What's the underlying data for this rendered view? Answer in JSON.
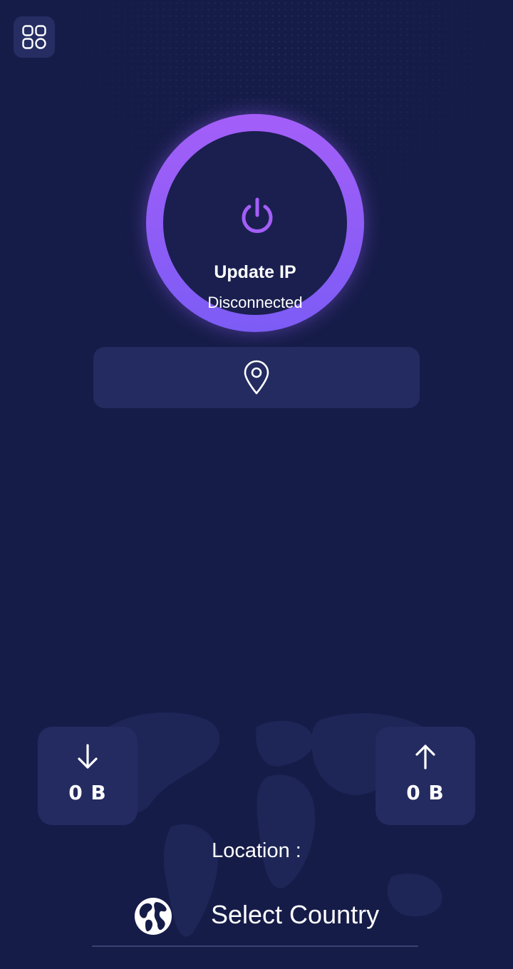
{
  "power": {
    "title": "Update IP",
    "status": "Disconnected"
  },
  "stats": {
    "download": "0 B",
    "upload": "0 B"
  },
  "location": {
    "label": "Location :",
    "country_placeholder": "Select Country"
  },
  "icons": {
    "menu": "grid-icon",
    "power": "power-icon",
    "pin": "map-pin-icon",
    "download": "arrow-down-icon",
    "upload": "arrow-up-icon",
    "globe": "globe-icon"
  },
  "colors": {
    "background": "#161c48",
    "card": "#232b61",
    "ring_start": "#a45ef8",
    "ring_end": "#7c5cf5",
    "accent": "#a45ef8"
  }
}
